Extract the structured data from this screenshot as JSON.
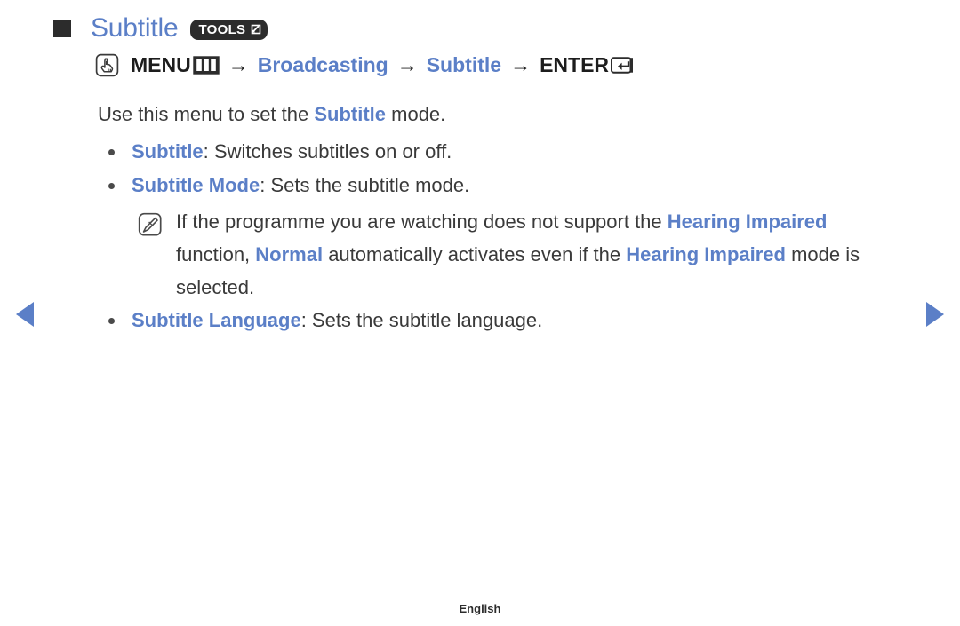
{
  "header": {
    "square_bullet": "black-square-bullet",
    "title": "Subtitle",
    "tools_badge": {
      "label": "TOOLS",
      "icon": "tools-arrow-icon"
    }
  },
  "nav_path": {
    "hand_icon": "hand-press-icon",
    "menu_label": "MENU",
    "menu_key_icon": "menu-key-icon",
    "arrow1": "→",
    "item_broadcasting": "Broadcasting",
    "arrow2": "→",
    "item_subtitle": "Subtitle",
    "arrow3": "→",
    "enter_label": "ENTER",
    "enter_key_icon": "enter-key-icon"
  },
  "content": {
    "intro": {
      "before": "Use this menu to set the ",
      "highlight": "Subtitle",
      "after": " mode."
    },
    "bullets": [
      {
        "term": "Subtitle",
        "description": ": Switches subtitles on or off."
      },
      {
        "term": "Subtitle Mode",
        "description": ": Sets the subtitle mode."
      }
    ],
    "note": {
      "icon": "note-pencil-icon",
      "seg1": "If the programme you are watching does not support the ",
      "hl1": "Hearing Impaired",
      "seg2": " function, ",
      "hl2": "Normal",
      "seg3": " automatically activates even if the ",
      "hl3": "Hearing Impaired",
      "seg4": " mode is selected."
    },
    "bullets_after_note": [
      {
        "term": "Subtitle Language",
        "description": ": Sets the subtitle language."
      }
    ]
  },
  "pagination": {
    "prev_icon": "previous-page-arrow",
    "next_icon": "next-page-arrow"
  },
  "footer": {
    "language": "English"
  },
  "colors": {
    "accent_blue": "#5b7fc7",
    "body_text": "#3a3a3a",
    "badge_dark": "#2c2c2c"
  }
}
